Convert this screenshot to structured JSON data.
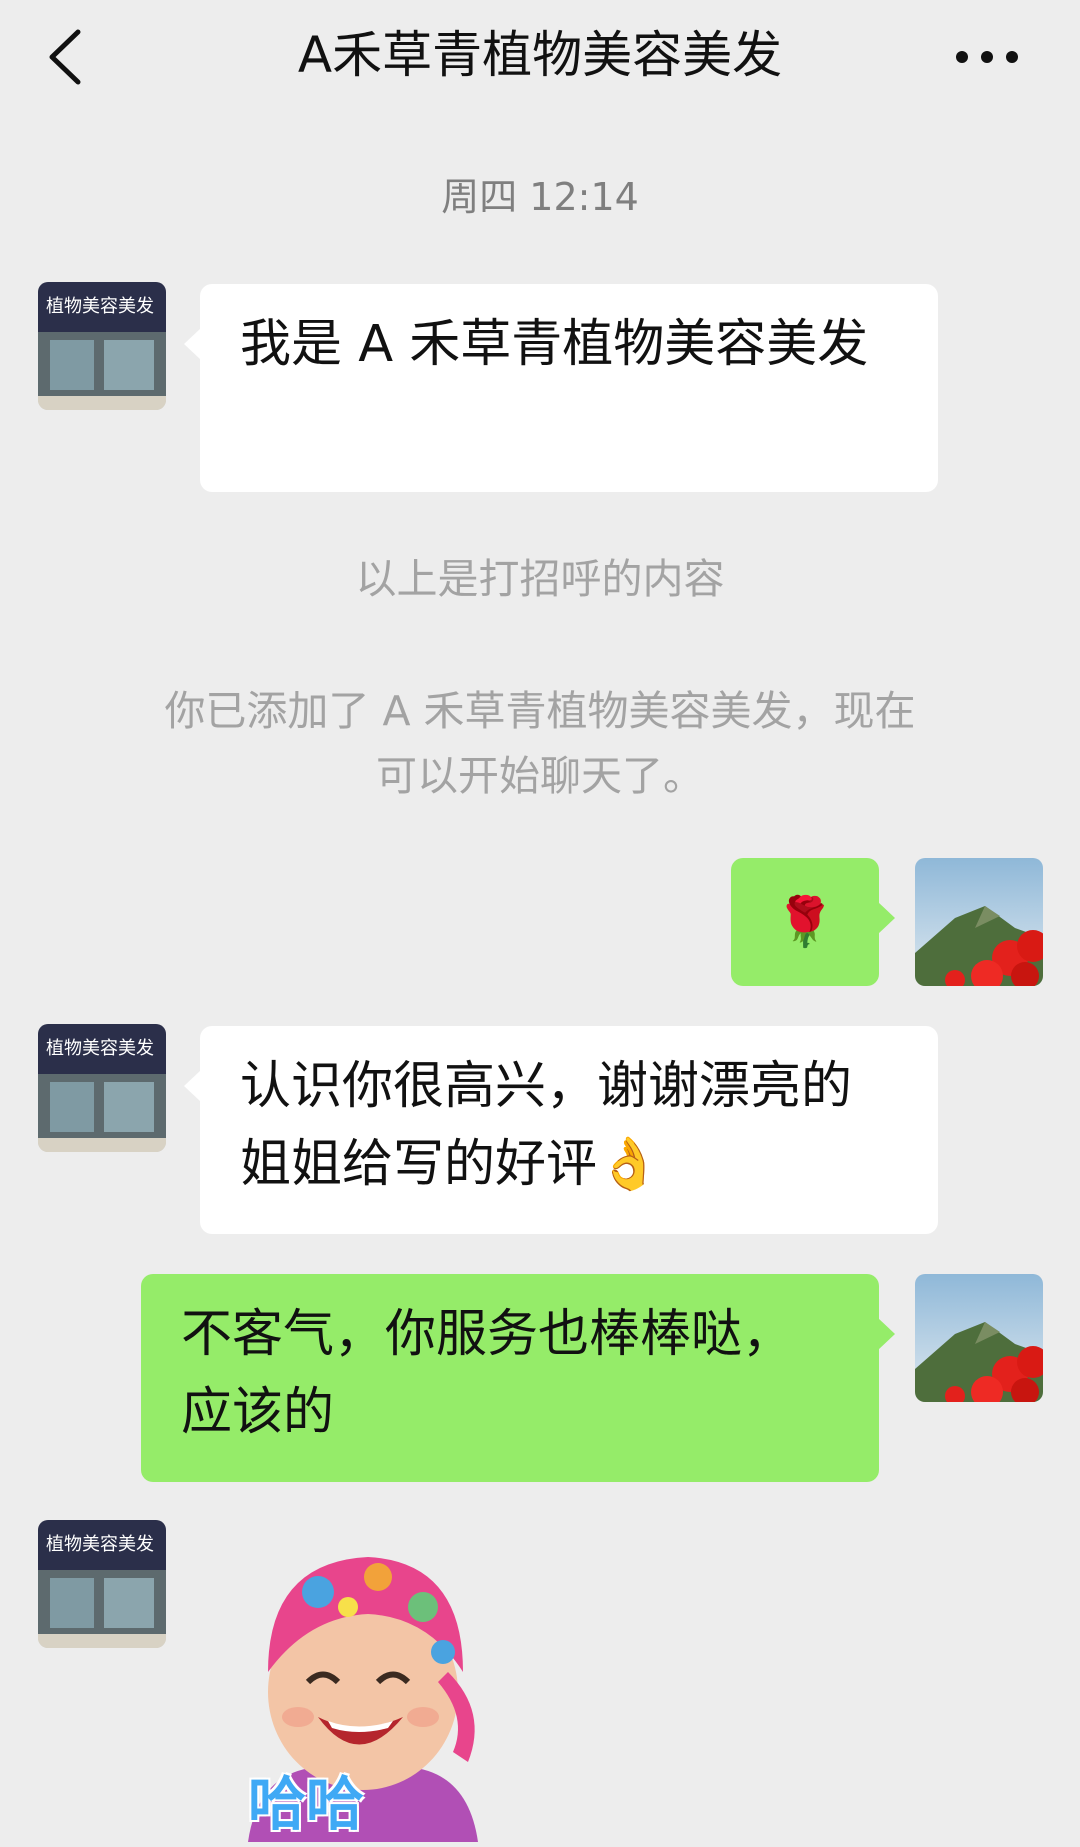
{
  "header": {
    "title": "A禾草青植物美容美发"
  },
  "chat": {
    "timestamp": "周四 12:14",
    "messages": [
      {
        "from": "contact",
        "text": "我是 A 禾草青植物美容美发"
      },
      {
        "from": "me",
        "text": "🌹"
      },
      {
        "from": "contact",
        "text": "认识你很高兴，谢谢漂亮的姐姐给写的好评👌"
      },
      {
        "from": "me",
        "text": "不客气，你服务也棒棒哒，应该的"
      }
    ],
    "system_greeting": "以上是打招呼的内容",
    "system_added_line1": "你已添加了 A 禾草青植物美容美发，现在",
    "system_added_line2": "可以开始聊天了。",
    "sticker_text": "哈哈"
  },
  "colors": {
    "background": "#ededed",
    "incoming_bubble": "#ffffff",
    "outgoing_bubble": "#95ec69",
    "system_text": "#a3a3a3"
  },
  "icons": {
    "back": "chevron-left-icon",
    "more": "more-dots-icon",
    "contact_avatar": "storefront-avatar",
    "my_avatar": "mountain-flowers-avatar"
  }
}
